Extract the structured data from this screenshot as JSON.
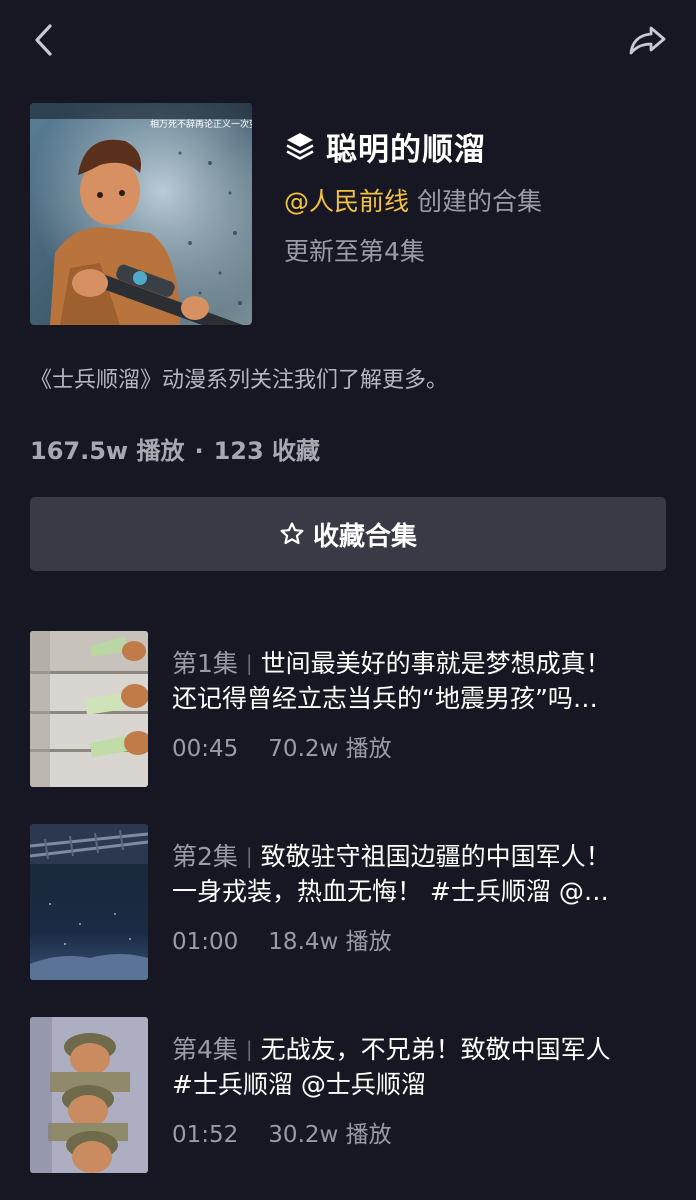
{
  "header": {
    "back_icon": "chevron-left-icon",
    "share_icon": "share-arrow-icon"
  },
  "collection": {
    "title": "聪明的顺溜",
    "title_icon": "layers-icon",
    "creator": "@人民前线",
    "creator_suffix": "创建的合集",
    "update_text": "更新至第4集",
    "description": "《士兵顺溜》动漫系列关注我们了解更多。",
    "plays": "167.5w 播放",
    "separator": "·",
    "favorites": "123 收藏",
    "cover_caption": "相万死不辞再论正义一次变代"
  },
  "collect_button": {
    "icon": "star-outline-icon",
    "label": "收藏合集"
  },
  "episodes": [
    {
      "number": "第1集",
      "sep": "|",
      "title_line1": "世间最美好的事就是梦想成真！",
      "title_line2": "还记得曾经立志当兵的“地震男孩”吗…",
      "duration": "00:45",
      "plays": "70.2w 播放"
    },
    {
      "number": "第2集",
      "sep": "|",
      "title_line1": "致敬驻守祖国边疆的中国军人！",
      "title_line2": "一身戎装，热血无悔！ #士兵顺溜 @…",
      "duration": "01:00",
      "plays": "18.4w 播放"
    },
    {
      "number": "第4集",
      "sep": "|",
      "title_line1": "无战友，不兄弟！致敬中国军人",
      "title_line2": "#士兵顺溜 @士兵顺溜",
      "duration": "01:52",
      "plays": "30.2w 播放"
    }
  ],
  "colors": {
    "background": "#161723",
    "accent": "#f4c23b",
    "button_bg": "#393a46",
    "muted_text": "#9a9ba3"
  }
}
